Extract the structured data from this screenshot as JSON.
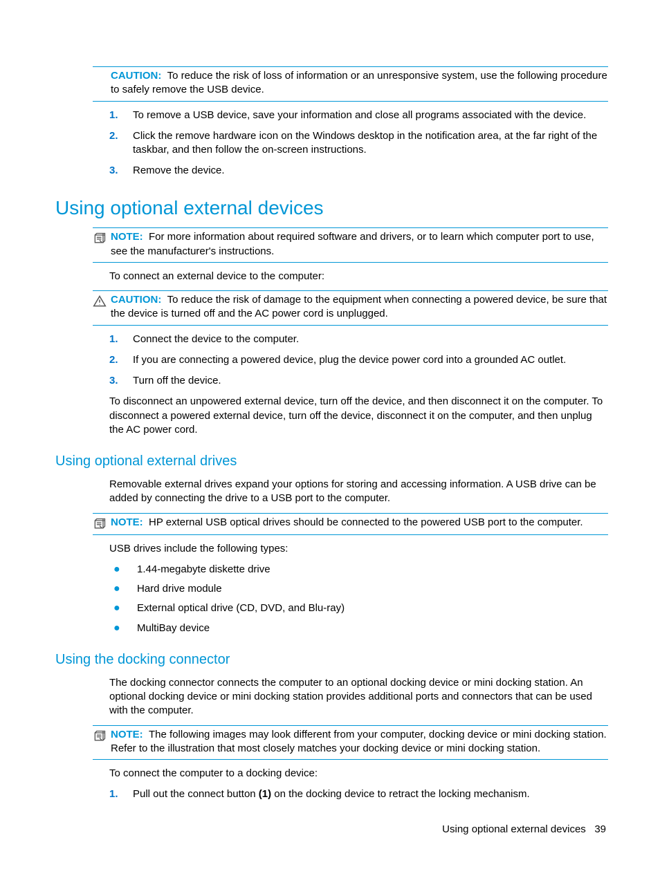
{
  "callout_caution_label": "CAUTION:",
  "callout_note_label": "NOTE:",
  "top": {
    "caution_text": "To reduce the risk of loss of information or an unresponsive system, use the following procedure to safely remove the USB device.",
    "steps": [
      "To remove a USB device, save your information and close all programs associated with the device.",
      "Click the remove hardware icon on the Windows desktop in the notification area, at the far right of the taskbar, and then follow the on-screen instructions.",
      "Remove the device."
    ]
  },
  "section1": {
    "heading": "Using optional external devices",
    "note_text": "For more information about required software and drivers, or to learn which computer port to use, see the manufacturer's instructions.",
    "para_intro": "To connect an external device to the computer:",
    "caution_text": "To reduce the risk of damage to the equipment when connecting a powered device, be sure that the device is turned off and the AC power cord is unplugged.",
    "steps": [
      "Connect the device to the computer.",
      "If you are connecting a powered device, plug the device power cord into a grounded AC outlet.",
      "Turn off the device."
    ],
    "para_disconnect": "To disconnect an unpowered external device, turn off the device, and then disconnect it on the computer. To disconnect a powered external device, turn off the device, disconnect it on the computer, and then unplug the AC power cord."
  },
  "section2": {
    "heading": "Using optional external drives",
    "para1": "Removable external drives expand your options for storing and accessing information. A USB drive can be added by connecting the drive to a USB port to the computer.",
    "note_text": "HP external USB optical drives should be connected to the powered USB port to the computer.",
    "para2": "USB drives include the following types:",
    "bullets": [
      "1.44-megabyte diskette drive",
      "Hard drive module",
      "External optical drive (CD, DVD, and Blu-ray)",
      "MultiBay device"
    ]
  },
  "section3": {
    "heading": "Using the docking connector",
    "para1": "The docking connector connects the computer to an optional docking device or mini docking station. An optional docking device or mini docking station provides additional ports and connectors that can be used with the computer.",
    "note_text": "The following images may look different from your computer, docking device or mini docking station. Refer to the illustration that most closely matches your docking device or mini docking station.",
    "para2": "To connect the computer to a docking device:",
    "step1_pre": "Pull out the connect button ",
    "step1_bold": "(1)",
    "step1_post": " on the docking device to retract the locking mechanism."
  },
  "footer": {
    "title": "Using optional external devices",
    "page": "39"
  }
}
